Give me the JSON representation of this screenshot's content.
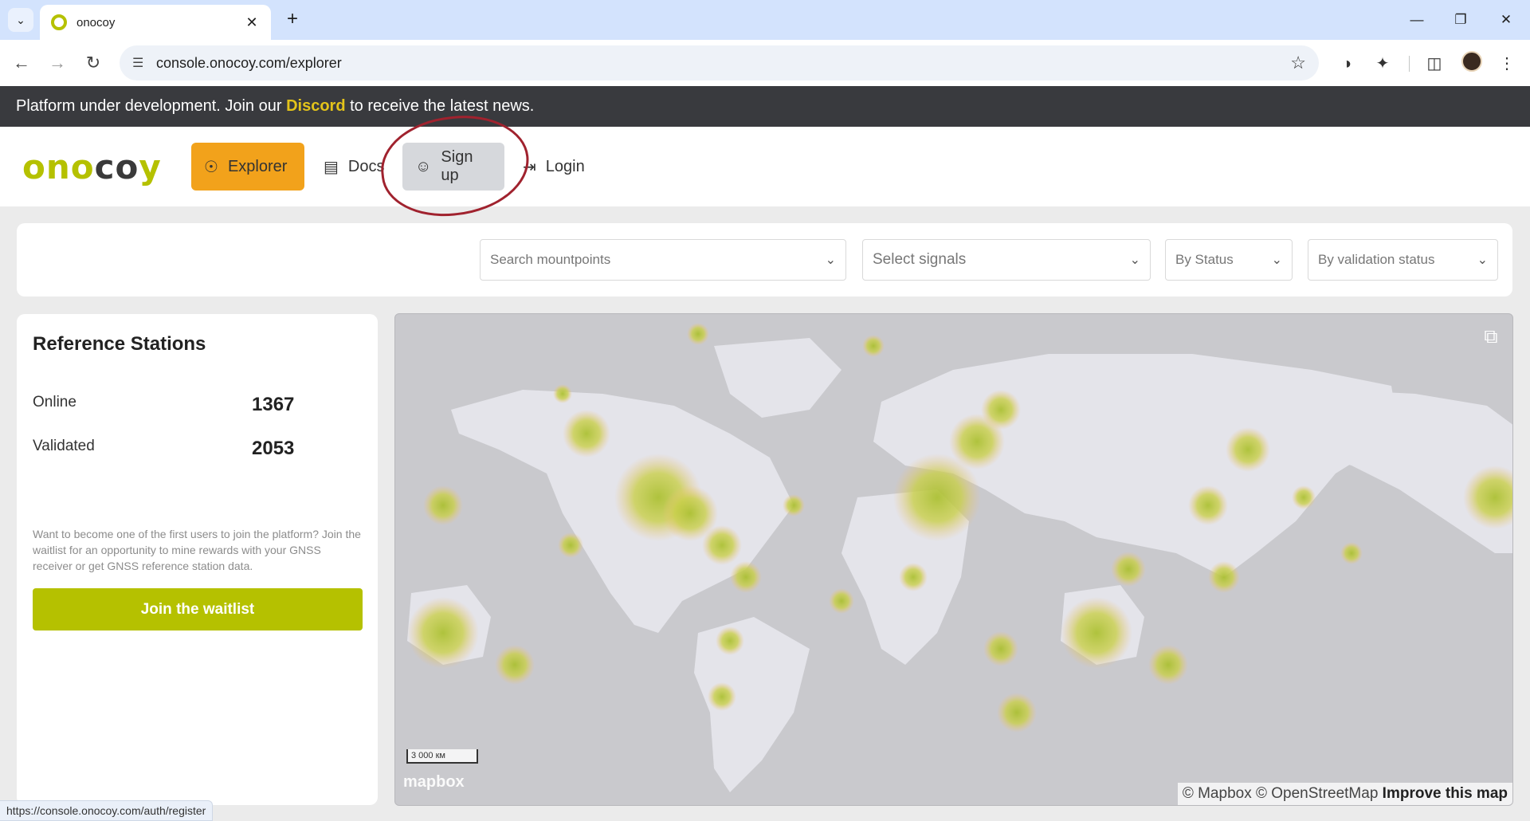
{
  "browser": {
    "tab_title": "onocoy",
    "url": "console.onocoy.com/explorer",
    "new_tab_label": "+",
    "status_url": "https://console.onocoy.com/auth/register"
  },
  "banner": {
    "prefix": "Platform under development. Join our ",
    "link": "Discord",
    "suffix": " to receive the latest news."
  },
  "header": {
    "logo_left": "ono",
    "logo_mid": "co",
    "logo_right": "y",
    "nav": {
      "explorer": "Explorer",
      "docs": "Docs",
      "signup": "Sign up",
      "login": "Login"
    }
  },
  "filters": {
    "search_placeholder": "Search mountpoints",
    "signals_placeholder": "Select signals",
    "status_placeholder": "By Status",
    "validation_placeholder": "By validation status"
  },
  "panel": {
    "title": "Reference Stations",
    "online_label": "Online",
    "online_value": "1367",
    "validated_label": "Validated",
    "validated_value": "2053",
    "waitlist_text": "Want to become one of the first users to join the platform? Join the waitlist for an opportunity to mine rewards with your GNSS receiver or get GNSS reference station data.",
    "waitlist_button": "Join the waitlist"
  },
  "map": {
    "scale_label": "3 000 км",
    "logo_text": "mapbox",
    "attribution": "© Mapbox © OpenStreetMap",
    "improve": "Improve this map",
    "colors": {
      "land": "#e4e4ea",
      "water": "#c9c9cd",
      "heat_core": "#a9bf2a",
      "heat_glow": "#f1c27d"
    }
  },
  "icons": {
    "tab_menu": "chevron-down-icon",
    "close": "close-icon",
    "back": "arrow-left-icon",
    "forward": "arrow-right-icon",
    "reload": "reload-icon",
    "site_info": "tune-icon",
    "bookmark": "star-icon",
    "explorer": "globe-icon",
    "docs": "document-icon",
    "signup": "user-plus-icon",
    "login": "login-icon",
    "fullscreen": "fullscreen-exit-icon"
  }
}
